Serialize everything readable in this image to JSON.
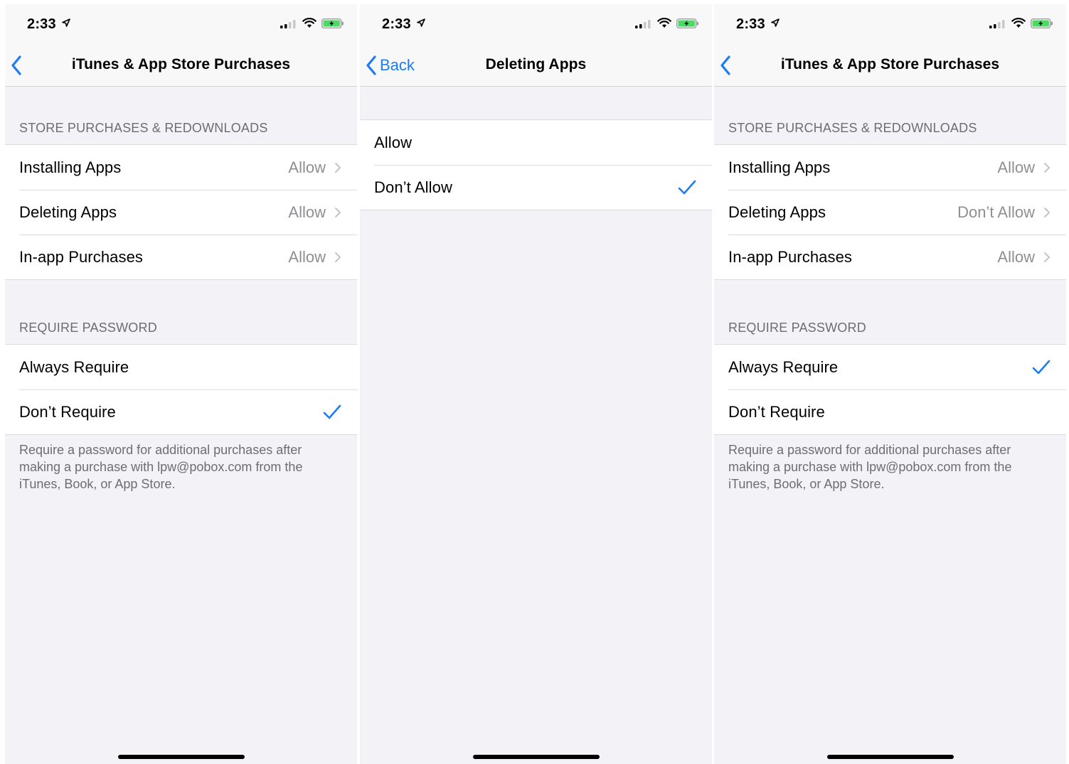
{
  "colors": {
    "accent": "#1e7cf2",
    "group_bg": "#f2f2f7",
    "secondary_text": "#6d6d72",
    "value_text": "#8e8e93"
  },
  "screens": [
    {
      "status": {
        "time": "2:33"
      },
      "nav": {
        "title": "iTunes & App Store Purchases",
        "back_label": ""
      },
      "sections": [
        {
          "header": "STORE PURCHASES & REDOWNLOADS",
          "rows": [
            {
              "label": "Installing Apps",
              "value": "Allow"
            },
            {
              "label": "Deleting Apps",
              "value": "Allow"
            },
            {
              "label": "In-app Purchases",
              "value": "Allow"
            }
          ]
        },
        {
          "header": "REQUIRE PASSWORD",
          "rows": [
            {
              "label": "Always Require",
              "checked": false
            },
            {
              "label": "Don’t Require",
              "checked": true
            }
          ],
          "footer": "Require a password for additional purchases after making a purchase with lpw@pobox.com from the iTunes, Book, or App Store."
        }
      ]
    },
    {
      "status": {
        "time": "2:33"
      },
      "nav": {
        "title": "Deleting Apps",
        "back_label": "Back"
      },
      "sections": [
        {
          "rows": [
            {
              "label": "Allow",
              "checked": false
            },
            {
              "label": "Don’t Allow",
              "checked": true
            }
          ]
        }
      ]
    },
    {
      "status": {
        "time": "2:33"
      },
      "nav": {
        "title": "iTunes & App Store Purchases",
        "back_label": ""
      },
      "sections": [
        {
          "header": "STORE PURCHASES & REDOWNLOADS",
          "rows": [
            {
              "label": "Installing Apps",
              "value": "Allow"
            },
            {
              "label": "Deleting Apps",
              "value": "Don’t Allow"
            },
            {
              "label": "In-app Purchases",
              "value": "Allow"
            }
          ]
        },
        {
          "header": "REQUIRE PASSWORD",
          "rows": [
            {
              "label": "Always Require",
              "checked": true
            },
            {
              "label": "Don’t Require",
              "checked": false
            }
          ],
          "footer": "Require a password for additional purchases after making a purchase with lpw@pobox.com from the iTunes, Book, or App Store."
        }
      ]
    }
  ]
}
